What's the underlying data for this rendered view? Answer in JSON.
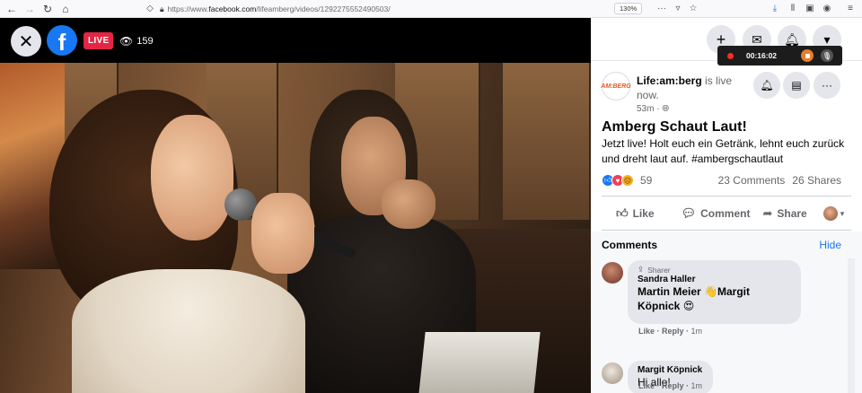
{
  "browser": {
    "url_prefix": "https://www.",
    "url_host": "facebook.com",
    "url_path": "/lifeamberg/videos/1292275552490503/",
    "zoom": "130%"
  },
  "video": {
    "live_label": "LIVE",
    "viewer_count": "159"
  },
  "recorder": {
    "time": "00:16:02"
  },
  "post": {
    "page_name": "Life:am:berg",
    "status_text": " is live now.",
    "avatar_text": "AM:BERG",
    "age": "53m",
    "title": "Amberg Schaut Laut!",
    "description": "Jetzt live! Holt euch ein Getränk, lehnt euch zurück und dreht laut auf. #ambergschautlaut",
    "reaction_count": "59",
    "comments_count": "23 Comments",
    "shares_count": "26 Shares",
    "like_label": "Like",
    "comment_label": "Comment",
    "share_label": "Share"
  },
  "comments": {
    "header": "Comments",
    "hide_label": "Hide",
    "items": [
      {
        "badge": "Sharer",
        "author": "Sandra Haller",
        "mention1": "Martin Meier",
        "mention2": "Margit",
        "line2": "Köpnick",
        "like": "Like",
        "reply": "Reply",
        "time": "1m"
      },
      {
        "author": "Margit Köpnick",
        "text": "Hi alle!",
        "like": "Like",
        "reply": "Reply",
        "time": "1m"
      }
    ]
  },
  "colors": {
    "facebook_blue": "#1877f2",
    "live_red": "#e42645"
  }
}
